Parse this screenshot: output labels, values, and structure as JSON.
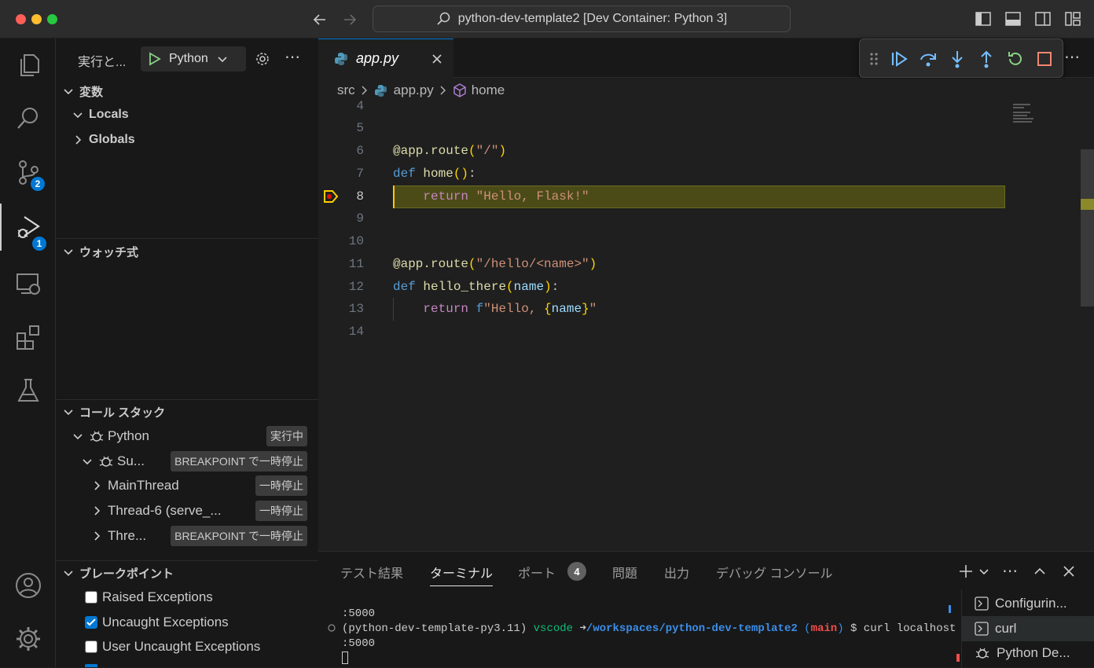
{
  "window": {
    "title": "python-dev-template2 [Dev Container: Python 3]"
  },
  "sidebar": {
    "run_label": "実行と...",
    "config_name": "Python",
    "variables": {
      "title": "変数",
      "items": [
        {
          "label": "Locals"
        },
        {
          "label": "Globals"
        }
      ]
    },
    "watch": {
      "title": "ウォッチ式"
    },
    "callstack": {
      "title": "コール スタック",
      "items": [
        {
          "label": "Python",
          "status": "実行中"
        },
        {
          "label": "Su...",
          "status": "BREAKPOINT で一時停止"
        },
        {
          "label": "MainThread",
          "status": "一時停止"
        },
        {
          "label": "Thread-6 (serve_...",
          "status": "一時停止"
        },
        {
          "label": "Thre...",
          "status": "BREAKPOINT で一時停止"
        }
      ]
    },
    "breakpoints": {
      "title": "ブレークポイント",
      "items": [
        {
          "label": "Raised Exceptions",
          "checked": false
        },
        {
          "label": "Uncaught Exceptions",
          "checked": true
        },
        {
          "label": "User Uncaught Exceptions",
          "checked": false
        }
      ]
    }
  },
  "activity_badges": {
    "source_control": "2",
    "run_debug": "1"
  },
  "editor": {
    "tab": {
      "label": "app.py"
    },
    "breadcrumbs": [
      "src",
      "app.py",
      "home"
    ],
    "lines": [
      {
        "n": "4"
      },
      {
        "n": "5"
      },
      {
        "n": "6"
      },
      {
        "n": "7"
      },
      {
        "n": "8"
      },
      {
        "n": "9"
      },
      {
        "n": "10"
      },
      {
        "n": "11"
      },
      {
        "n": "12"
      },
      {
        "n": "13"
      },
      {
        "n": "14"
      }
    ],
    "code": {
      "l6_dec": "@app",
      "l6_fn": ".route",
      "l6_str": "\"/\"",
      "l7_kw": "def",
      "l7_fn": "home",
      "l8_kw": "return",
      "l8_str": "\"Hello, Flask!\"",
      "l11_dec": "@app",
      "l11_fn": ".route",
      "l11_str": "\"/hello/<name>\"",
      "l12_kw": "def",
      "l12_fn": "hello_there",
      "l12_var": "name",
      "l13_kw": "return",
      "l13_f": "f",
      "l13_str1": "\"Hello, ",
      "l13_var": "name",
      "l13_str2": "\""
    }
  },
  "panel": {
    "tabs": [
      {
        "label": "テスト結果"
      },
      {
        "label": "ターミナル"
      },
      {
        "label": "ポート"
      },
      {
        "label": "問題"
      },
      {
        "label": "出力"
      },
      {
        "label": "デバッグ コンソール"
      }
    ],
    "ports_badge": "4",
    "terminal": {
      "line1": ":5000",
      "env": "(python-dev-template-py3.11)",
      "user": "vscode",
      "arrow": "➜",
      "path": "/workspaces/python-dev-template2",
      "branch_open": " (",
      "branch": "main",
      "branch_close": ")",
      "cmd": " $ curl localhost",
      "line3": ":5000"
    },
    "terminal_list": [
      {
        "label": "Configurin..."
      },
      {
        "label": "curl"
      },
      {
        "label": "Python De..."
      }
    ]
  }
}
